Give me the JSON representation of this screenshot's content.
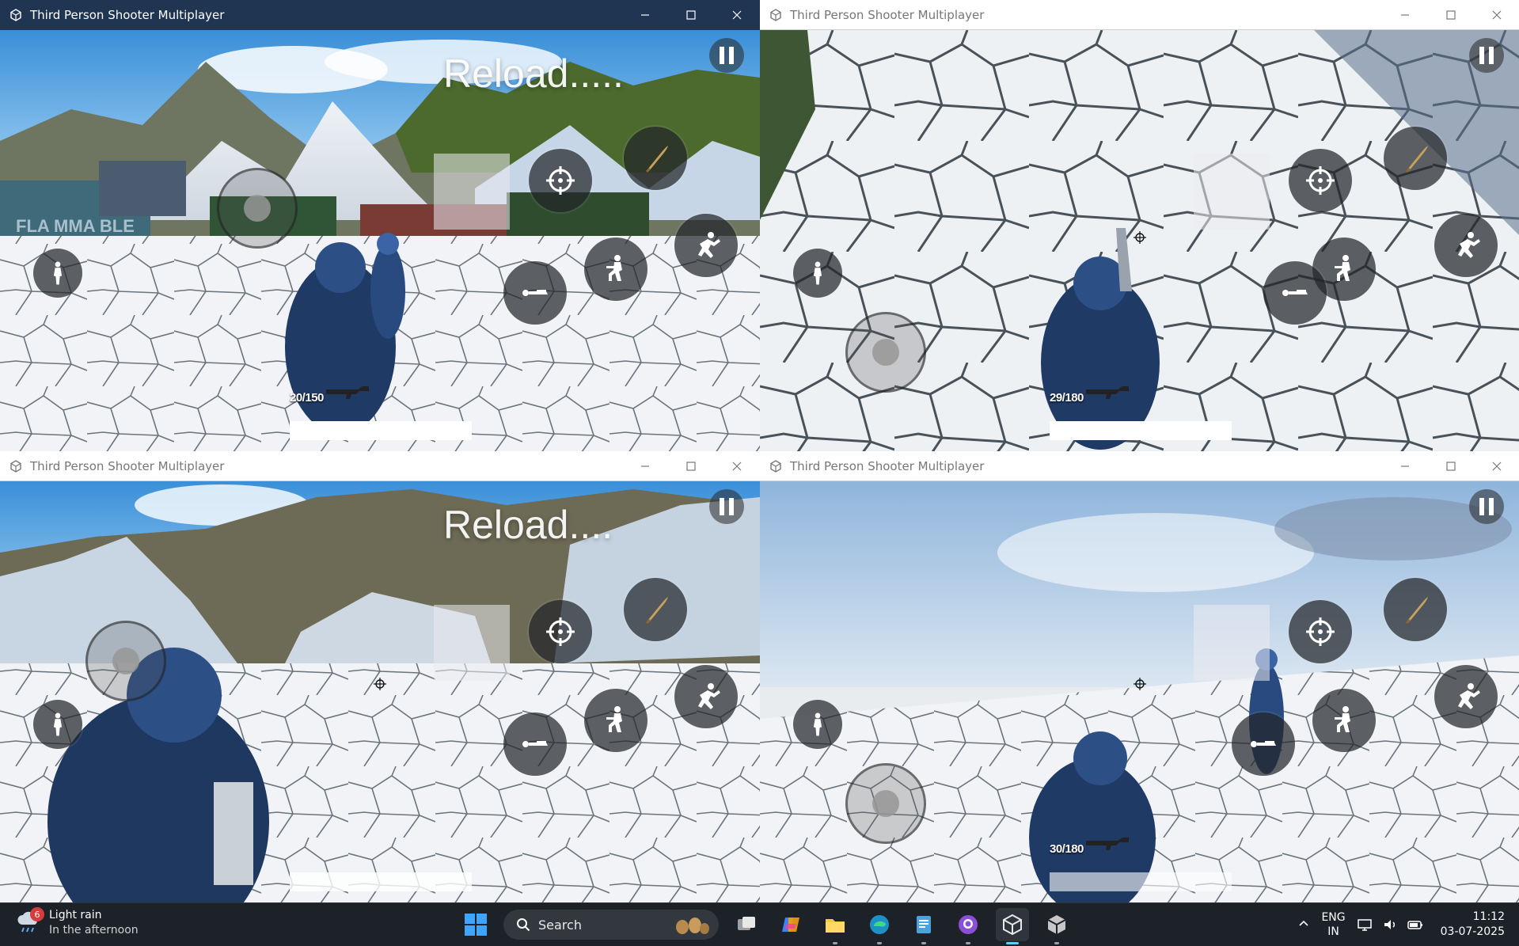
{
  "windows": [
    {
      "id": "tl",
      "title": "Third Person Shooter Multiplayer",
      "active": true,
      "reload_text": "Reload.....",
      "ammo": "20/150",
      "scene": "mountains"
    },
    {
      "id": "tr",
      "title": "Third Person Shooter Multiplayer",
      "active": false,
      "reload_text": "",
      "ammo": "29/180",
      "scene": "ground"
    },
    {
      "id": "bl",
      "title": "Third Person Shooter Multiplayer",
      "active": false,
      "reload_text": "Reload....",
      "ammo": "",
      "scene": "mountains2"
    },
    {
      "id": "br",
      "title": "Third Person Shooter Multiplayer",
      "active": false,
      "reload_text": "",
      "ammo": "30/180",
      "scene": "sky"
    }
  ],
  "icons": {
    "window_controls": [
      "minimize-icon",
      "maximize-icon",
      "close-icon"
    ],
    "hud": [
      "pause-icon",
      "aim-crosshair-icon",
      "bullet-icon",
      "soldier-run-icon",
      "crouch-icon",
      "jump-roll-icon",
      "prone-icon",
      "rifle-icon"
    ]
  },
  "taskbar": {
    "weather": {
      "badge": "6",
      "title": "Light rain",
      "subtitle": "In the afternoon"
    },
    "search_placeholder": "Search",
    "language": {
      "line1": "ENG",
      "line2": "IN"
    },
    "clock": {
      "time": "11:12",
      "date": "03-07-2025"
    }
  },
  "colors": {
    "active_titlebar": "#1f3552",
    "taskbar": "#1d2229",
    "hud_button": "#23262a"
  }
}
